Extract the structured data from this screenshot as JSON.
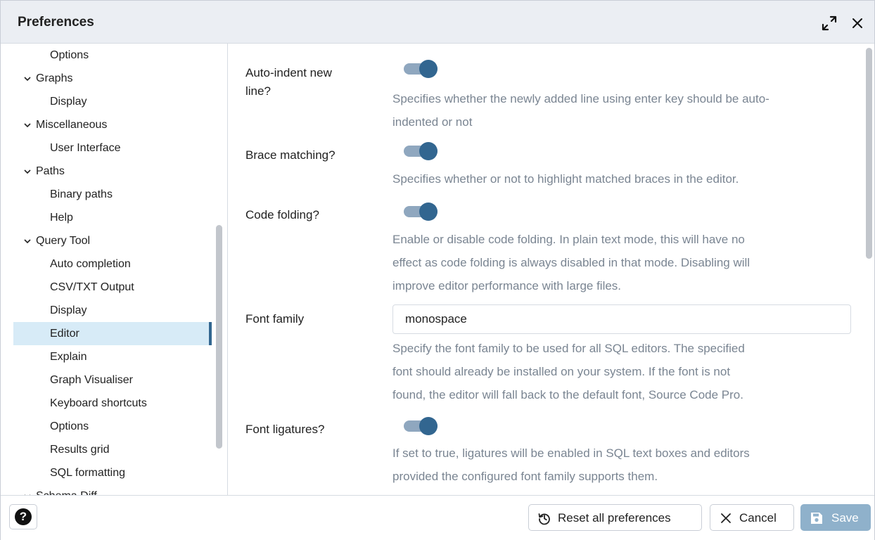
{
  "title": "Preferences",
  "sidebar": {
    "items": [
      {
        "label": "Options",
        "level": "child"
      },
      {
        "label": "Graphs",
        "level": "parent"
      },
      {
        "label": "Display",
        "level": "child"
      },
      {
        "label": "Miscellaneous",
        "level": "parent"
      },
      {
        "label": "User Interface",
        "level": "child"
      },
      {
        "label": "Paths",
        "level": "parent"
      },
      {
        "label": "Binary paths",
        "level": "child"
      },
      {
        "label": "Help",
        "level": "child"
      },
      {
        "label": "Query Tool",
        "level": "parent"
      },
      {
        "label": "Auto completion",
        "level": "child"
      },
      {
        "label": "CSV/TXT Output",
        "level": "child"
      },
      {
        "label": "Display",
        "level": "child"
      },
      {
        "label": "Editor",
        "level": "child",
        "selected": true
      },
      {
        "label": "Explain",
        "level": "child"
      },
      {
        "label": "Graph Visualiser",
        "level": "child"
      },
      {
        "label": "Keyboard shortcuts",
        "level": "child"
      },
      {
        "label": "Options",
        "level": "child"
      },
      {
        "label": "Results grid",
        "level": "child"
      },
      {
        "label": "SQL formatting",
        "level": "child"
      },
      {
        "label": "Schema Diff",
        "level": "parent"
      }
    ]
  },
  "settings": {
    "auto_indent": {
      "label_line1": "Auto-indent new",
      "label_line2": "line?",
      "enabled": true,
      "desc_line1": "Specifies whether the newly added line using enter key should be auto-",
      "desc_line2": "indented or not"
    },
    "brace_matching": {
      "label": "Brace matching?",
      "enabled": true,
      "desc_line1": "Specifies whether or not to highlight matched braces in the editor."
    },
    "code_folding": {
      "label": "Code folding?",
      "enabled": true,
      "desc_line1": "Enable or disable code folding. In plain text mode, this will have no",
      "desc_line2": "effect as code folding is always disabled in that mode. Disabling will",
      "desc_line3": "improve editor performance with large files."
    },
    "font_family": {
      "label": "Font family",
      "value": "monospace",
      "desc_line1": "Specify the font family to be used for all SQL editors. The specified",
      "desc_line2": "font should already be installed on your system. If the font is not",
      "desc_line3": "found, the editor will fall back to the default font, Source Code Pro."
    },
    "font_ligatures": {
      "label": "Font ligatures?",
      "enabled": true,
      "desc_line1": "If set to true, ligatures will be enabled in SQL text boxes and editors",
      "desc_line2": "provided the configured font family supports them."
    }
  },
  "footer": {
    "help_glyph": "?",
    "reset_label": "Reset all preferences",
    "cancel_label": "Cancel",
    "save_label": "Save"
  },
  "colors": {
    "accent": "#326690",
    "selected_bg": "#d7ebf7",
    "description_text": "#7a8592",
    "save_disabled": "#8fb1cb"
  },
  "icons": {
    "maximize": "maximize-icon",
    "close": "close-icon",
    "help": "help-icon",
    "reset": "reset-icon",
    "cancel": "x-icon",
    "save": "save-icon",
    "expand": "chevron-down-icon"
  }
}
